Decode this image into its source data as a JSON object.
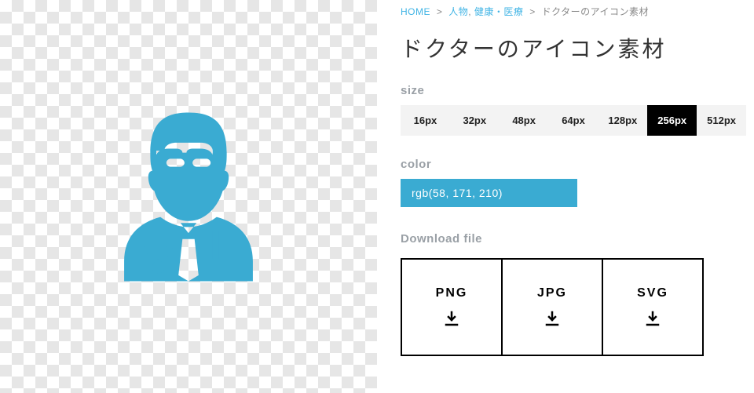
{
  "breadcrumb": {
    "home": "HOME",
    "cat1": "人物",
    "cat2": "健康・医療",
    "current": "ドクターのアイコン素材"
  },
  "title": "ドクターのアイコン素材",
  "labels": {
    "size": "size",
    "color": "color",
    "download": "Download file"
  },
  "sizes": [
    "16px",
    "32px",
    "48px",
    "64px",
    "128px",
    "256px",
    "512px"
  ],
  "selected_size": "256px",
  "color_value": "rgb(58, 171, 210)",
  "accent_hex": "#3aabd2",
  "downloads": [
    "PNG",
    "JPG",
    "SVG"
  ],
  "picker": {
    "sv_x": 0.62,
    "sv_y": 0.14,
    "hue_pos": 0.52
  }
}
